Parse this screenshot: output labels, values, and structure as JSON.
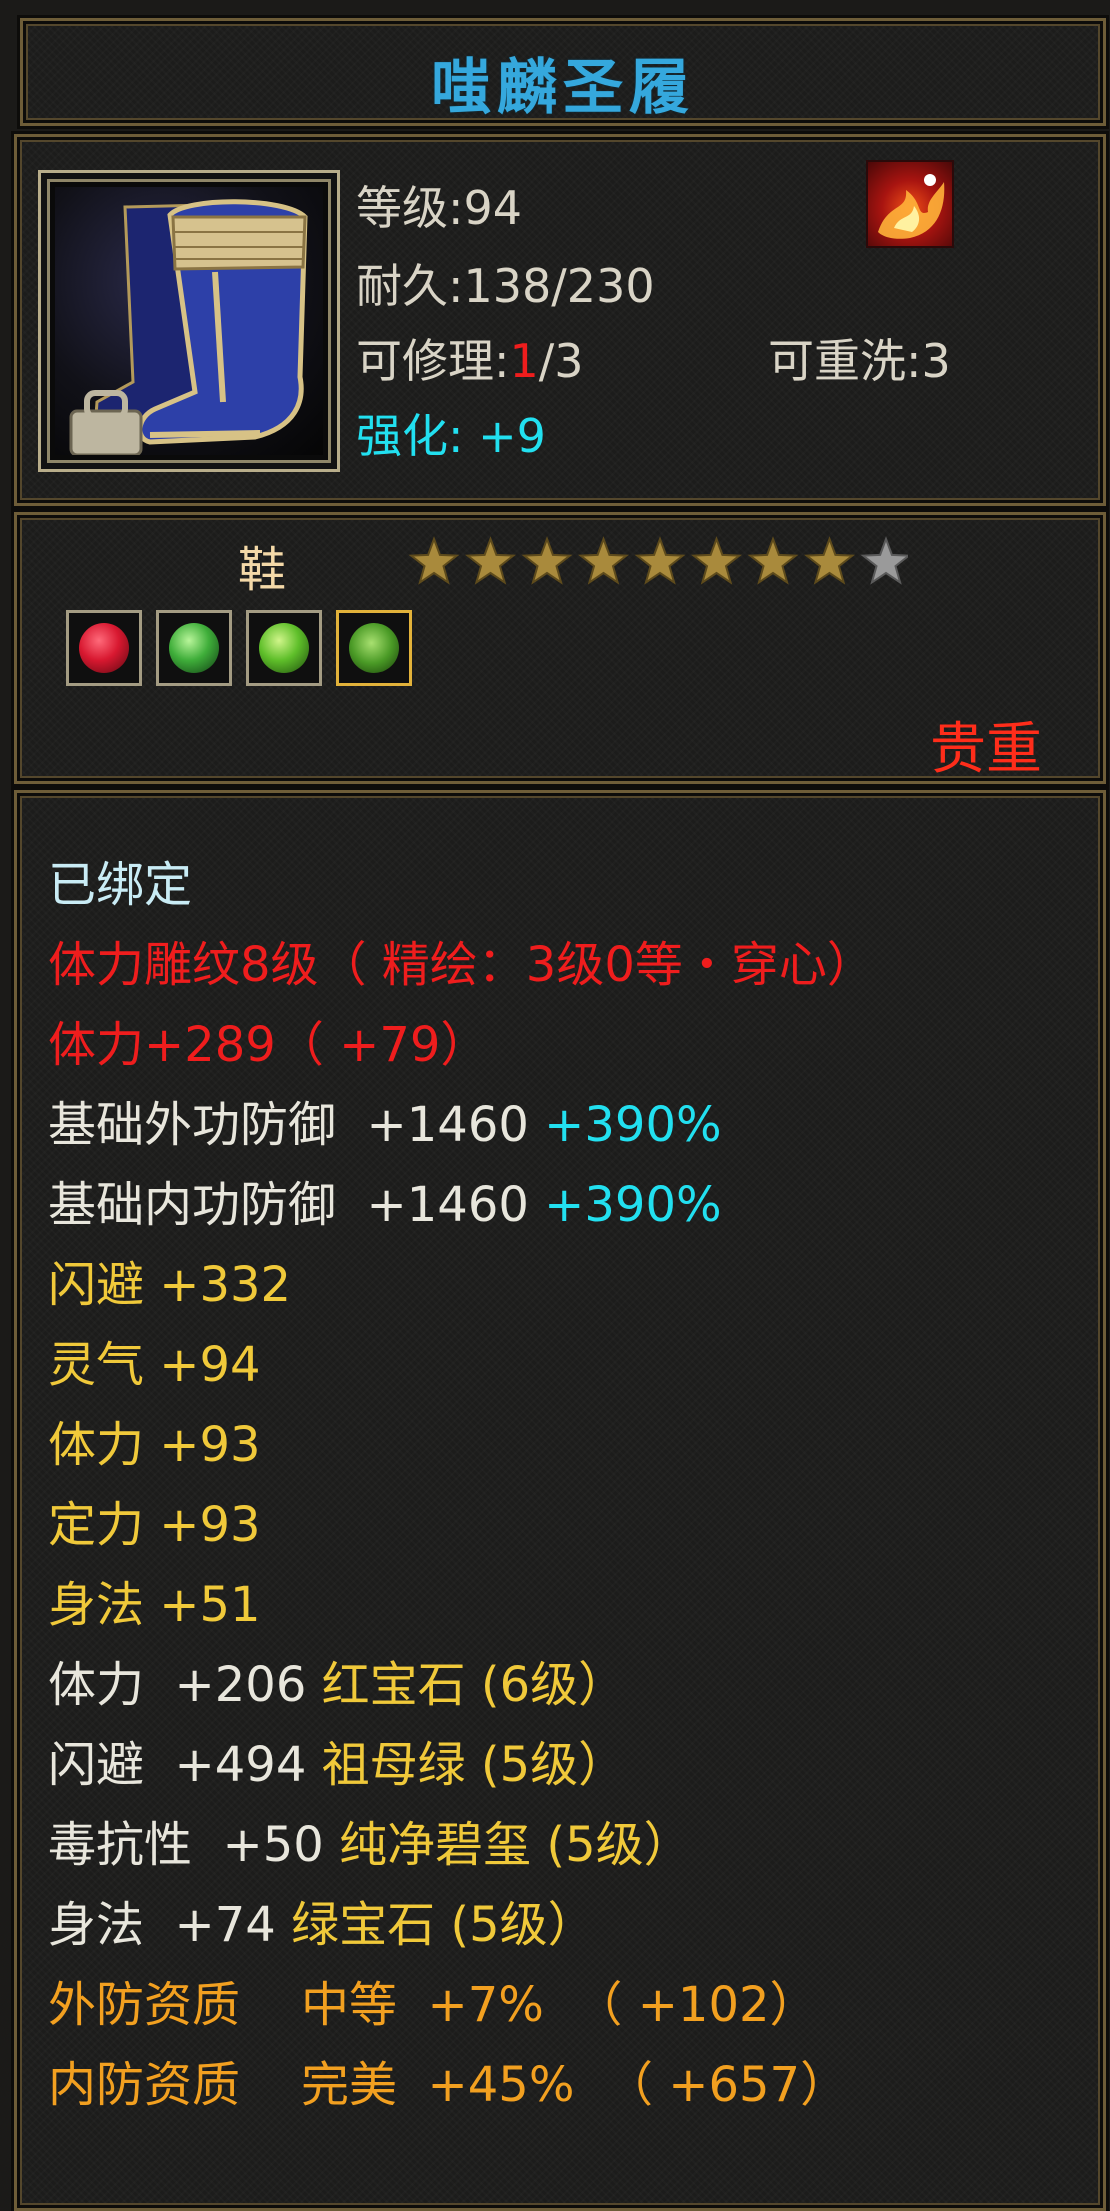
{
  "item": {
    "name": "嗤麟圣履",
    "level_label": "等级:",
    "level_value": "94",
    "durability_label": "耐久:",
    "durability_value": "138/230",
    "repair_label": "可修理:",
    "repair_used": "1",
    "repair_total": "/3",
    "rewash_label": "可重洗:",
    "rewash_value": "3",
    "enhance_label": "强化:",
    "enhance_value": "+9",
    "slot_type": "鞋",
    "stars_filled": 8,
    "stars_total": 9,
    "rarity": "贵重",
    "icon": "blue-boots-icon",
    "skill_icon": "flame-skill-icon"
  },
  "gems": [
    {
      "icon": "red-gem-icon",
      "color": "#d81830"
    },
    {
      "icon": "green-gem-icon",
      "color": "#3fae3a"
    },
    {
      "icon": "green-gem-icon",
      "color": "#5fbf2a"
    },
    {
      "icon": "green-gem-icon",
      "color": "#4a9a26"
    }
  ],
  "stats": {
    "bound": "已绑定",
    "engrave": "体力雕纹8级（ 精绘：3级0等・穿心）",
    "strength_total": "体力+289（ +79）",
    "ext_def": {
      "label": "基础外功防御  +1460 ",
      "bonus": "+390%"
    },
    "int_def": {
      "label": "基础内功防御  +1460 ",
      "bonus": "+390%"
    },
    "attrs": [
      "闪避  +332",
      "灵气  +94",
      "体力  +93",
      "定力  +93",
      "身法  +51"
    ],
    "gem_lines": [
      {
        "stat": "体力  +206 ",
        "gem": "红宝石 (6级）"
      },
      {
        "stat": "闪避  +494 ",
        "gem": "祖母绿 (5级）"
      },
      {
        "stat": "毒抗性  +50 ",
        "gem": "纯净碧玺 (5级）"
      },
      {
        "stat": "身法  +74 ",
        "gem": "绿宝石 (5级）"
      }
    ],
    "ext_quality": "外防资质    中等  +7%  （ +102）",
    "int_quality": "内防资质    完美  +45%  （ +657）"
  },
  "colors": {
    "title": "#35a8dd",
    "red": "#ef1d1d",
    "cyan": "#22e0f0",
    "yellow": "#f0c93a",
    "orange": "#f2a020",
    "gold_frame": "#6e5d38"
  }
}
